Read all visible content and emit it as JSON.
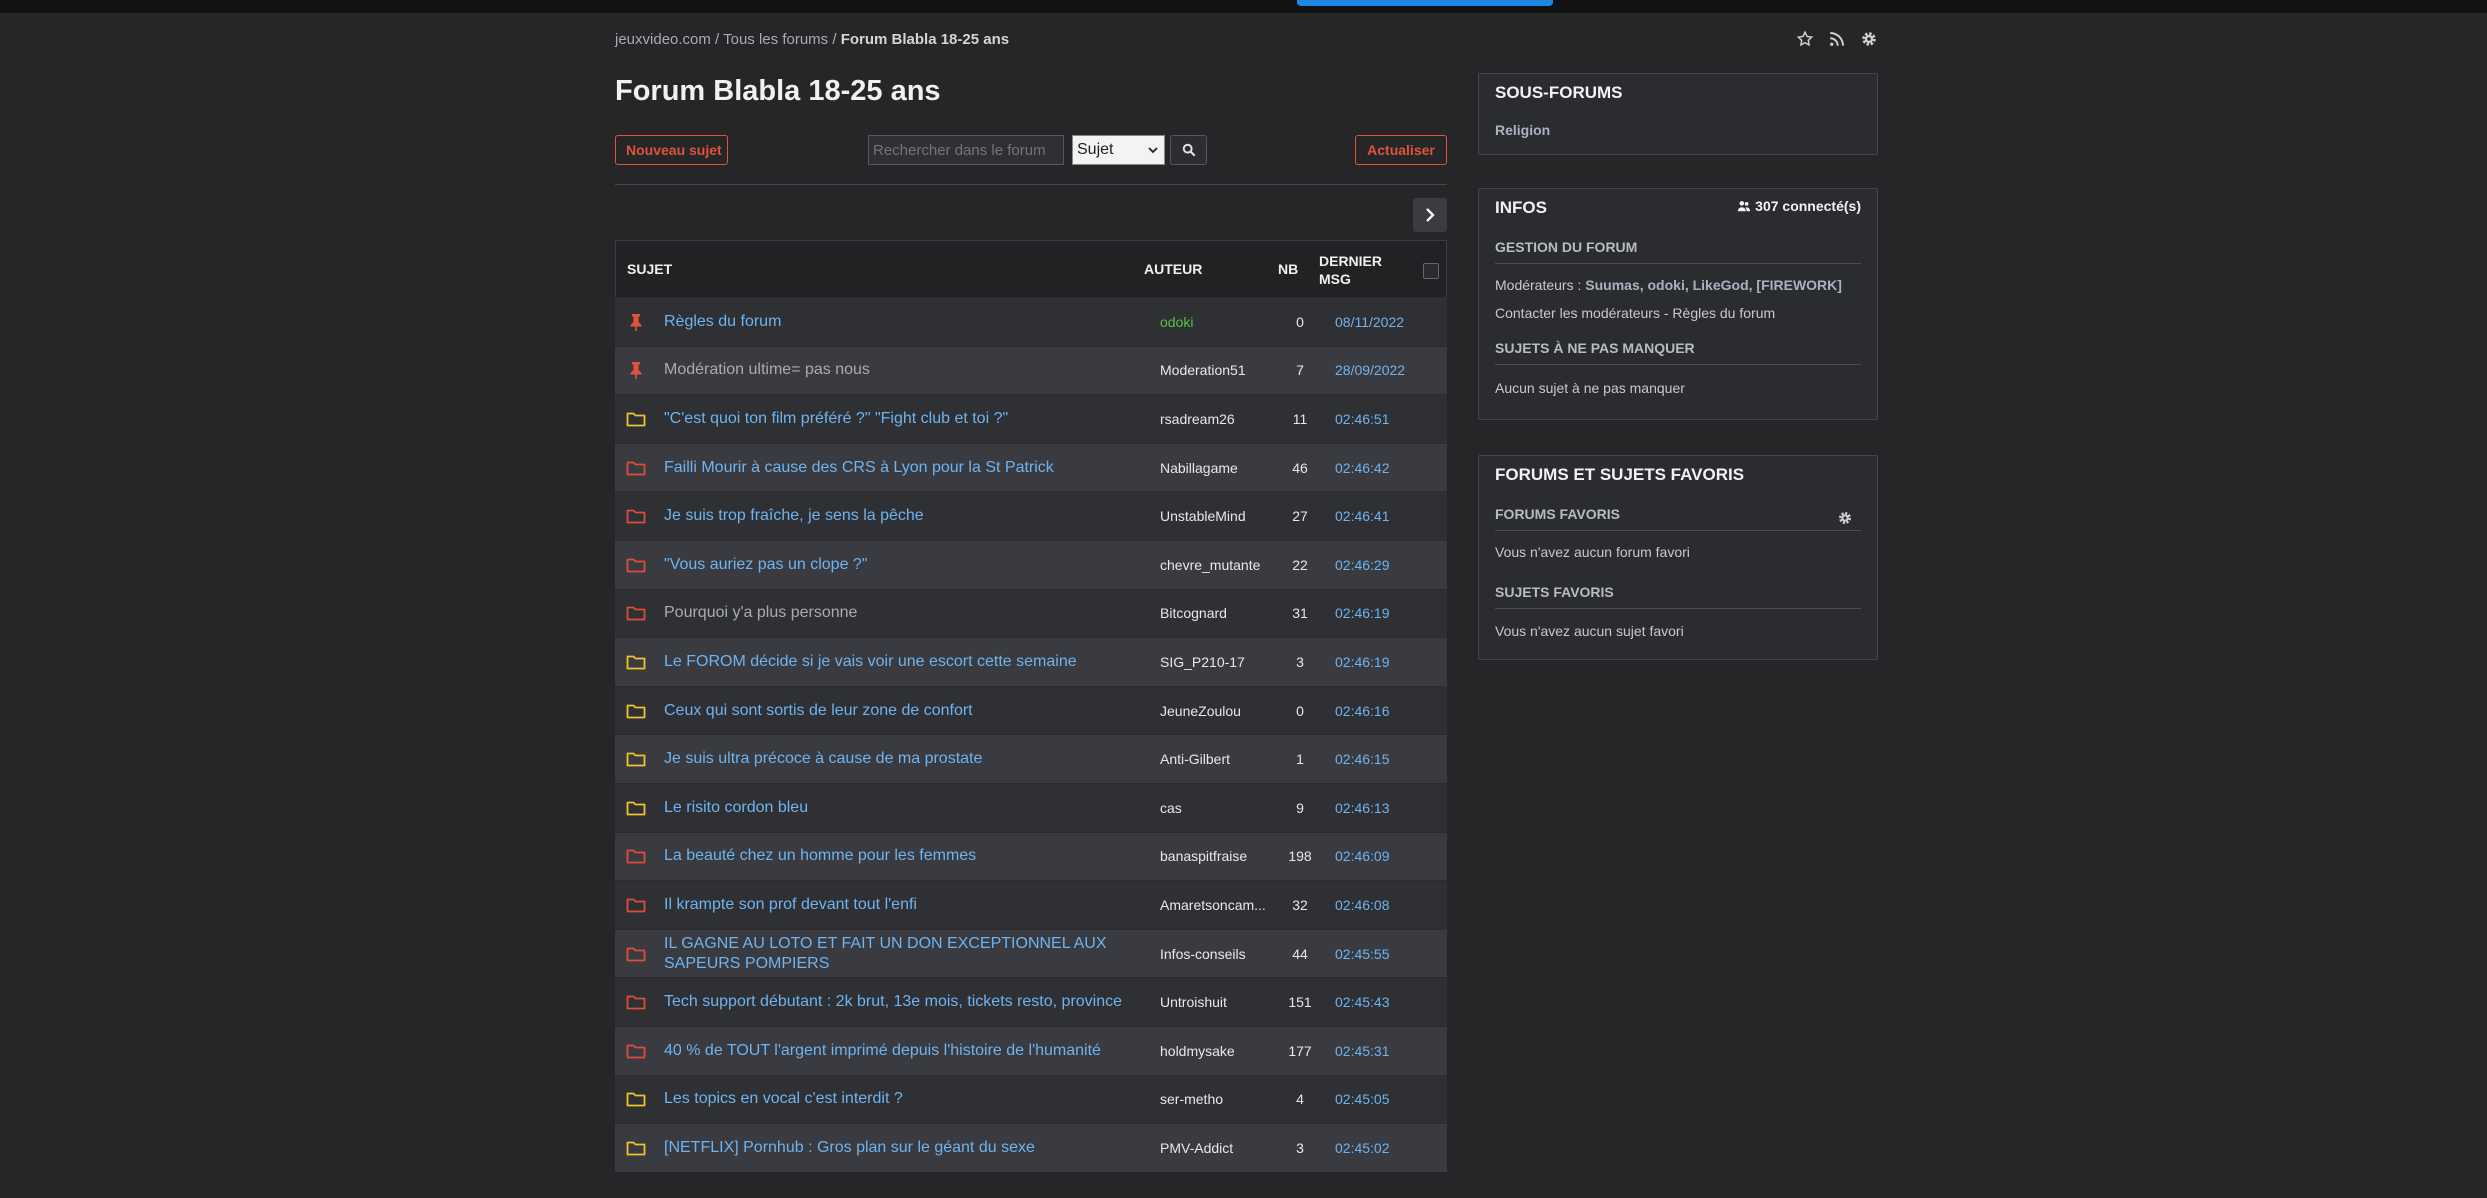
{
  "breadcrumb": {
    "site": "jeuxvideo.com",
    "sep1": " / ",
    "all": "Tous les forums",
    "sep2": " / ",
    "current": "Forum Blabla 18-25 ans"
  },
  "page": {
    "title": "Forum Blabla 18-25 ans"
  },
  "toolbar": {
    "new_topic": "Nouveau sujet",
    "search_placeholder": "Rechercher dans le forum",
    "search_scope": "Sujet",
    "refresh": "Actualiser"
  },
  "table": {
    "headers": {
      "subject": "SUJET",
      "author": "AUTEUR",
      "nb": "NB",
      "last_line1": "DERNIER",
      "last_line2": "MSG"
    },
    "rows": [
      {
        "icon": "pin-icon",
        "title": "Règles du forum",
        "author": "odoki",
        "nb": "0",
        "last": "08/11/2022"
      },
      {
        "icon": "pin-icon",
        "title": "Modération ultime= pas nous",
        "author": "Moderation51",
        "nb": "7",
        "last": "28/09/2022"
      },
      {
        "icon": "folder-yellow-icon",
        "title": "\"C'est quoi ton film préféré ?\" \"Fight club et toi ?\"",
        "author": "rsadream26",
        "nb": "11",
        "last": "02:46:51"
      },
      {
        "icon": "folder-red-icon",
        "title": "Failli Mourir à cause des CRS à Lyon pour la St Patrick",
        "author": "Nabillagame",
        "nb": "46",
        "last": "02:46:42"
      },
      {
        "icon": "folder-red-icon",
        "title": "Je suis trop fraîche, je sens la pêche",
        "author": "UnstableMind",
        "nb": "27",
        "last": "02:46:41"
      },
      {
        "icon": "folder-red-icon",
        "title": "\"Vous auriez pas un clope ?\"",
        "author": "chevre_mutante",
        "nb": "22",
        "last": "02:46:29"
      },
      {
        "icon": "folder-red-icon",
        "title": "Pourquoi y'a plus personne",
        "author": "Bitcognard",
        "nb": "31",
        "last": "02:46:19"
      },
      {
        "icon": "folder-yellow-icon",
        "title": "Le FOROM décide si je vais voir une escort cette semaine",
        "author": "SIG_P210-17",
        "nb": "3",
        "last": "02:46:19"
      },
      {
        "icon": "folder-yellow-icon",
        "title": "Ceux qui sont sortis de leur zone de confort",
        "author": "JeuneZoulou",
        "nb": "0",
        "last": "02:46:16"
      },
      {
        "icon": "folder-yellow-icon",
        "title": "Je suis ultra précoce à cause de ma prostate",
        "author": "Anti-Gilbert",
        "nb": "1",
        "last": "02:46:15"
      },
      {
        "icon": "folder-yellow-icon",
        "title": "Le risito cordon bleu",
        "author": "cas",
        "nb": "9",
        "last": "02:46:13"
      },
      {
        "icon": "folder-red-icon",
        "title": "La beauté chez un homme pour les femmes",
        "author": "banaspitfraise",
        "nb": "198",
        "last": "02:46:09"
      },
      {
        "icon": "folder-red-icon",
        "title": "Il krampte son prof devant tout l'enfi",
        "author": "Amaretsoncam...",
        "nb": "32",
        "last": "02:46:08"
      },
      {
        "icon": "folder-red-icon",
        "title": "IL GAGNE AU LOTO ET FAIT UN DON EXCEPTIONNEL AUX SAPEURS POMPIERS",
        "author": "Infos-conseils",
        "nb": "44",
        "last": "02:45:55"
      },
      {
        "icon": "folder-red-icon",
        "title": "Tech support débutant : 2k brut, 13e mois, tickets resto, province",
        "author": "Untroishuit",
        "nb": "151",
        "last": "02:45:43"
      },
      {
        "icon": "folder-red-icon",
        "title": "40 % de TOUT l'argent imprimé depuis l'histoire de l'humanité",
        "author": "holdmysake",
        "nb": "177",
        "last": "02:45:31"
      },
      {
        "icon": "folder-yellow-icon",
        "title": "Les topics en vocal c'est interdit ?",
        "author": "ser-metho",
        "nb": "4",
        "last": "02:45:05"
      },
      {
        "icon": "folder-yellow-icon",
        "title": "[NETFLIX] Pornhub : Gros plan sur le géant du sexe",
        "author": "PMV-Addict",
        "nb": "3",
        "last": "02:45:02"
      }
    ]
  },
  "sidebar": {
    "subforums": {
      "title": "SOUS-FORUMS",
      "items": [
        "Religion"
      ]
    },
    "infos": {
      "title": "INFOS",
      "online": "307 connecté(s)",
      "gestion_title": "GESTION DU FORUM",
      "moderators_label": "Modérateurs : ",
      "moderators": "Suumas, odoki, LikeGod, [FIREWORK]",
      "contact": "Contacter les modérateurs",
      "contact_sep": " - ",
      "rules": "Règles du forum",
      "must_title": "SUJETS À NE PAS MANQUER",
      "must_empty": "Aucun sujet à ne pas manquer"
    },
    "favorites": {
      "title": "FORUMS ET SUJETS FAVORIS",
      "forums_title": "FORUMS FAVORIS",
      "forums_empty": "Vous n'avez aucun forum favori",
      "topics_title": "SUJETS FAVORIS",
      "topics_empty": "Vous n'avez aucun sujet favori"
    }
  },
  "colors": {
    "accent": "#e0533b",
    "link": "#6fb3ef",
    "pin": "#e0533b",
    "folder_yellow": "#f2c12e",
    "folder_red": "#e04b3b",
    "moderator": "#5cbf4a"
  }
}
